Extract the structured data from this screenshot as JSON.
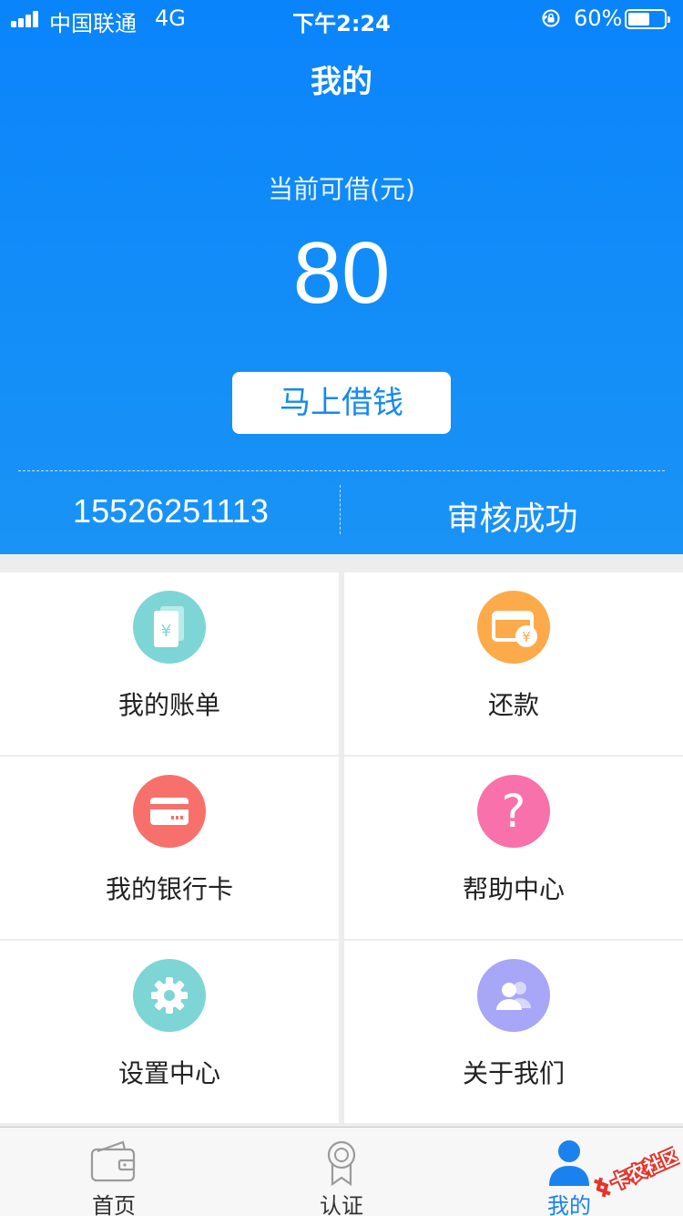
{
  "status_bar": {
    "carrier": "中国联通",
    "network": "4G",
    "time": "下午2:24",
    "battery_percent": "60%",
    "battery_level": 0.6
  },
  "header": {
    "title": "我的",
    "available_label": "当前可借(元)",
    "available_amount": "80",
    "borrow_button": "马上借钱",
    "phone": "15526251113",
    "review_status": "审核成功"
  },
  "menu": [
    {
      "label": "我的账单",
      "icon": "bill-icon",
      "color": "#7ed5d5"
    },
    {
      "label": "还款",
      "icon": "repay-icon",
      "color": "#fdaa4a"
    },
    {
      "label": "我的银行卡",
      "icon": "bank-card-icon",
      "color": "#f8706b"
    },
    {
      "label": "帮助中心",
      "icon": "help-icon",
      "color": "#f871aa"
    },
    {
      "label": "设置中心",
      "icon": "settings-icon",
      "color": "#7ed5d5"
    },
    {
      "label": "关于我们",
      "icon": "about-us-icon",
      "color": "#a7a6f7"
    }
  ],
  "tabbar": {
    "tabs": [
      {
        "label": "首页",
        "icon": "wallet-icon"
      },
      {
        "label": "认证",
        "icon": "badge-icon"
      },
      {
        "label": "我的",
        "icon": "person-icon"
      }
    ],
    "active_color": "#1a82ee"
  },
  "watermark": {
    "text": "卡农社区"
  }
}
